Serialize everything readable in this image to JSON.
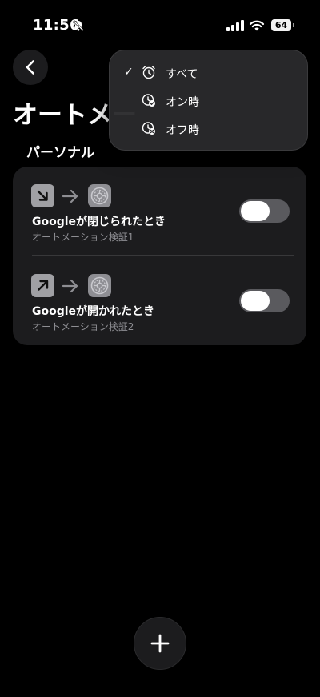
{
  "status_bar": {
    "time": "11:56",
    "battery_level": "64",
    "icons": [
      "bell-off-icon",
      "signal-icon",
      "wifi-icon",
      "battery-icon"
    ]
  },
  "nav": {
    "back_icon": "chevron-left-icon"
  },
  "page": {
    "title": "オートメー",
    "section_header": "パーソナル"
  },
  "automations": [
    {
      "title": "Googleが閉じられたとき",
      "subtitle": "オートメーション検証1",
      "trigger_icon": "arrow-down-right-icon",
      "action_icon": "settings-icon",
      "enabled": true
    },
    {
      "title": "Googleが開かれたとき",
      "subtitle": "オートメーション検証2",
      "trigger_icon": "arrow-up-right-icon",
      "action_icon": "settings-icon",
      "enabled": true
    }
  ],
  "filter_menu": {
    "selected": "すべて",
    "items": [
      {
        "label": "すべて",
        "icon": "alarm-clock-icon",
        "checked": true
      },
      {
        "label": "オン時",
        "icon": "clock-check-icon",
        "checked": false
      },
      {
        "label": "オフ時",
        "icon": "clock-x-icon",
        "checked": false
      }
    ]
  },
  "add_button": {
    "icon": "plus-icon"
  },
  "colors": {
    "background": "#000000",
    "card": "#1c1c1e",
    "secondary_text": "#8e8e93",
    "toggle_track": "#5a5a5e"
  }
}
